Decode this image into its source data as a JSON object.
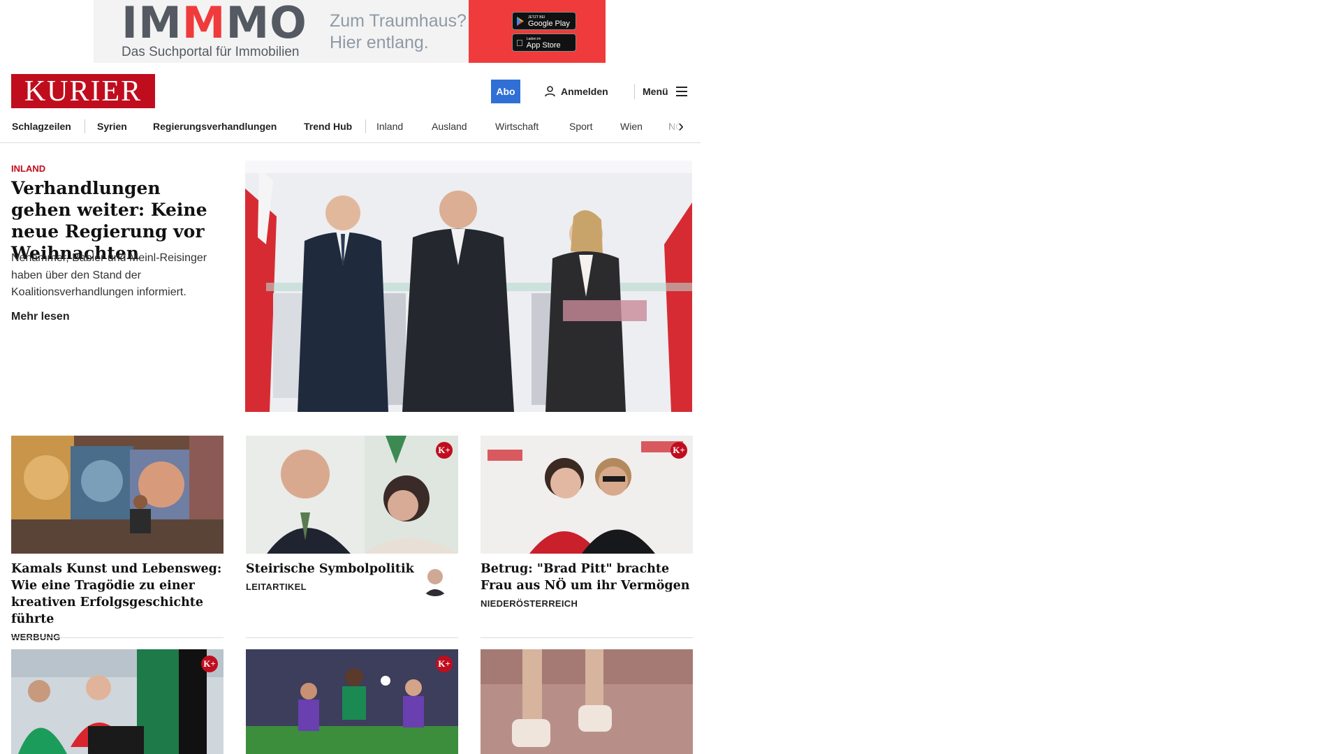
{
  "ad": {
    "logo": "IMMMO",
    "logo_parts": [
      "IM",
      "M",
      "MO"
    ],
    "subtitle": "Das Suchportal für Immobilien",
    "tagline_line1": "Zum Traumhaus?",
    "tagline_line2": "Hier entlang.",
    "google_play_small": "JETZT BEI",
    "google_play": "Google Play",
    "app_store_small": "Laden im",
    "app_store": "App Store",
    "accent_color": "#ef3b3b"
  },
  "header": {
    "logo_text": "KURIER",
    "brand_color": "#c00d1e",
    "abo_label": "Abo",
    "abo_color": "#2f6fd6",
    "login_label": "Anmelden",
    "menu_label": "Menü"
  },
  "nav": {
    "items": [
      {
        "label": "Schlagzeilen",
        "bold": true
      },
      {
        "label": "Syrien",
        "bold": true
      },
      {
        "label": "Regierungsverhandlungen",
        "bold": true
      },
      {
        "label": "Trend Hub",
        "bold": true
      },
      {
        "label": "Inland",
        "bold": false
      },
      {
        "label": "Ausland",
        "bold": false
      },
      {
        "label": "Wirtschaft",
        "bold": false
      },
      {
        "label": "Sport",
        "bold": false
      },
      {
        "label": "Wien",
        "bold": false
      },
      {
        "label": "NÖ",
        "bold": false
      }
    ]
  },
  "lead": {
    "category": "INLAND",
    "title": "Verhandlungen gehen weiter: Keine neue Regie­rung vor Weihnachten",
    "teaser": "Nehammer, Babler und Meinl-Reisinger haben über den Stand der Koalitionsverhandlungen informiert.",
    "more_label": "Mehr lesen"
  },
  "cards": [
    {
      "title": "Kamals Kunst und Lebensweg: Wie eine Tragödie zu einer kreativen Erfolgsgeschichte führte",
      "category": "WERBUNG",
      "premium": false
    },
    {
      "title": "Steirische Symbolpolitik",
      "category": "LEITARTIKEL",
      "premium": true
    },
    {
      "title": "Betrug: \"Brad Pitt\" brachte Frau aus NÖ um ihr Vermögen",
      "category": "NIEDERÖSTERREICH",
      "premium": true
    },
    {
      "title": "",
      "category": "",
      "premium": true
    },
    {
      "title": "",
      "category": "",
      "premium": true
    },
    {
      "title": "",
      "category": "",
      "premium": false
    }
  ],
  "premium_badge": "K+"
}
